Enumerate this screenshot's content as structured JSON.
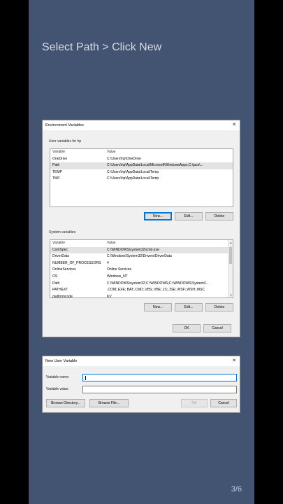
{
  "slide": {
    "title": "Select Path > Click New",
    "counter": "3/6"
  },
  "env_dialog": {
    "title": "Environment Variables",
    "user_section_label": "User variables for hp",
    "user_columns": [
      "Variable",
      "Value"
    ],
    "user_rows": [
      {
        "variable": "OneDrive",
        "value": "C:\\Users\\hp\\OneDrive"
      },
      {
        "variable": "Path",
        "value": "C:\\Users\\hp\\AppData\\Local\\Microsoft\\WindowsApps;C:\\java\\..."
      },
      {
        "variable": "TEMP",
        "value": "C:\\Users\\hp\\AppData\\Local\\Temp"
      },
      {
        "variable": "TMP",
        "value": "C:\\Users\\hp\\AppData\\Local\\Temp"
      }
    ],
    "user_buttons": {
      "new": "New...",
      "edit": "Edit...",
      "delete": "Delete"
    },
    "system_section_label": "System variables",
    "system_columns": [
      "Variable",
      "Value"
    ],
    "system_rows": [
      {
        "variable": "ComSpec",
        "value": "C:\\WINDOWS\\system32\\cmd.exe"
      },
      {
        "variable": "DriverData",
        "value": "C:\\Windows\\System32\\Drivers\\DriverData"
      },
      {
        "variable": "NUMBER_OF_PROCESSORS",
        "value": "4"
      },
      {
        "variable": "OnlineServices",
        "value": "Online Services"
      },
      {
        "variable": "OS",
        "value": "Windows_NT"
      },
      {
        "variable": "Path",
        "value": "C:\\WINDOWS\\system32;C:\\WINDOWS;C:\\WINDOWS\\System3..."
      },
      {
        "variable": "PATHEXT",
        "value": ".COM;.EXE;.BAT;.CMD;.VBS;.VBE;.JS;.JSE;.WSF;.WSH;.MSC"
      },
      {
        "variable": "platformcode",
        "value": "KV"
      }
    ],
    "system_buttons": {
      "new": "New...",
      "edit": "Edit...",
      "delete": "Delete"
    },
    "ok": "OK",
    "cancel": "Cancel",
    "close_glyph": "✕"
  },
  "new_var_dialog": {
    "title": "New User Variable",
    "name_label": "Variable name:",
    "value_label": "Variable value:",
    "name_value": "",
    "value_value": "",
    "browse_directory": "Browse Directory...",
    "browse_file": "Browse File...",
    "ok": "OK",
    "cancel": "Cancel",
    "close_glyph": "✕"
  },
  "colors": {
    "slide_bg": "#435372",
    "dialog_bg": "#f0f0f0",
    "focus_accent": "#0078d7"
  }
}
